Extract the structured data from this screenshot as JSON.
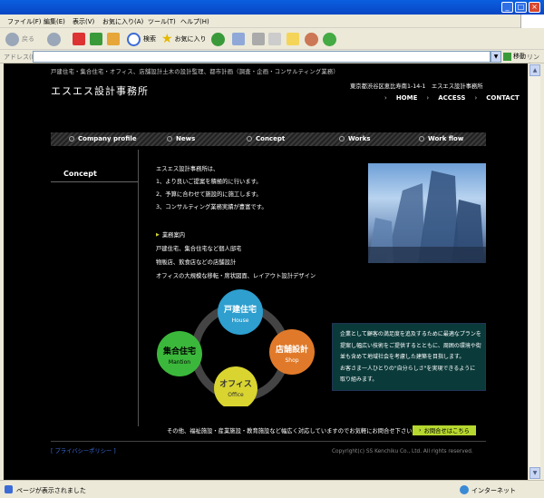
{
  "browser": {
    "menu": [
      "ファイル(F)",
      "編集(E)",
      "表示(V)",
      "お気に入り(A)",
      "ツール(T)",
      "ヘルプ(H)"
    ],
    "toolbar": {
      "back": "戻る",
      "search": "検索",
      "favorites": "お気に入り"
    },
    "address_label": "アドレス(D)",
    "address_value": "",
    "go_label": "移動",
    "links_label": "リンク",
    "status_text": "ページが表示されました",
    "zone_text": "インターネット"
  },
  "site": {
    "tagline": "戸建住宅・集合住宅・オフィス、店舗設計土木の設計監理、都市計画（調査・企画・コンサルティング業務）",
    "title": "エスエス設計事務所",
    "address": "東京都渋谷区恵比寿南1-14-1　エスエス設計事務所",
    "topnav": [
      "HOME",
      "ACCESS",
      "CONTACT"
    ],
    "nav": [
      "Company profile",
      "News",
      "Concept",
      "Works",
      "Work flow"
    ],
    "sidebar_title": "Concept",
    "intro": [
      "エスエス設計事務所は、",
      "1、より良いご提案を積極的に行います。",
      "2、予算に合わせて施設的に施工します。",
      "3、コンサルティング業務実績が豊富です。"
    ],
    "services_title": "業務案内",
    "services": [
      "戸建住宅、集合住宅など個人邸宅",
      "物販店、飲食店などの店舗設計",
      "オフィスの大規模な移転・席状図面、レイアウト設計デザイン"
    ],
    "diagram": {
      "top": {
        "jp": "戸建住宅",
        "en": "House",
        "color": "#2e9fcf"
      },
      "left": {
        "jp": "集合住宅",
        "en": "Mantion",
        "color": "#3bb83b"
      },
      "right": {
        "jp": "店舗設計",
        "en": "Shop",
        "color": "#e07a2a"
      },
      "bottom": {
        "jp": "オフィス",
        "en": "Office",
        "color": "#d9d430"
      }
    },
    "info": [
      "企業として顧客の満足度を追及するために最適なプランを",
      "提案し幅広い技術をご提供するとともに、周囲の環境や街",
      "並も含めて地域社会を考慮した建築を目指します。",
      "お客さま一人ひとりの\"自分らしさ\"を実現できるように",
      "取り組みます。"
    ],
    "footer_note": "その他、福祉施設・産業施設・教育施設など幅広く対応していますのでお気軽にお問合せ下さい。",
    "contact_button": "お問合せはこちら",
    "privacy": "[ プライバシーポリシー ]",
    "copyright": "Copyright(c) SS Kenchiku Co., Ltd. All rights reserved."
  }
}
